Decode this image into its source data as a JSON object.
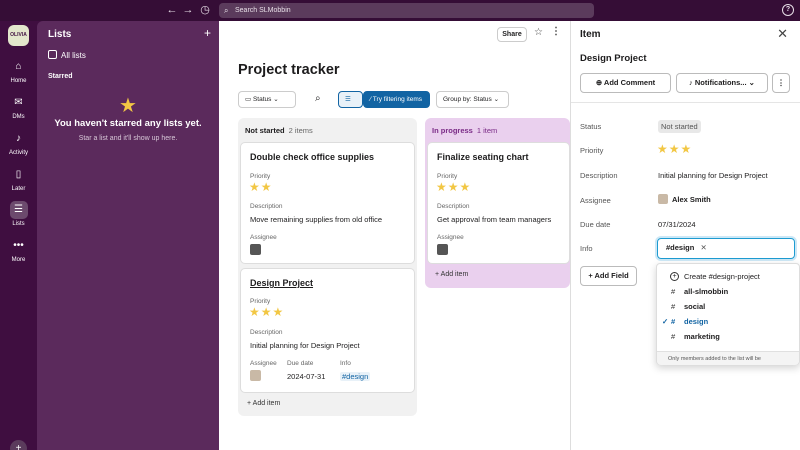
{
  "topbar": {
    "back_icon": "arrow-left-icon",
    "forward_icon": "arrow-right-icon",
    "history_icon": "clock-icon",
    "search_placeholder": "Search SLMobbin",
    "help_label": "?"
  },
  "workspace": {
    "label": "OLIVIA"
  },
  "rail": [
    {
      "label": "Home",
      "icon": "home-icon"
    },
    {
      "label": "DMs",
      "icon": "dms-icon"
    },
    {
      "label": "Activity",
      "icon": "bell-icon"
    },
    {
      "label": "Later",
      "icon": "bookmark-icon"
    },
    {
      "label": "Lists",
      "icon": "lists-icon"
    },
    {
      "label": "More",
      "icon": "more-icon"
    }
  ],
  "lists_sidebar": {
    "title": "Lists",
    "add": "+",
    "all_lists": "All lists",
    "starred_header": "Starred",
    "empty_title": "You haven't starred any lists yet.",
    "empty_sub": "Star a list and it'll show up here."
  },
  "main": {
    "share": "Share",
    "title": "Project tracker",
    "toolbar": {
      "status": "Status",
      "filter": "Try filtering items",
      "group_by": "Group by: Status"
    },
    "columns": {
      "not_started": {
        "name": "Not started",
        "count": "2 items",
        "add_item": "Add item",
        "cards": [
          {
            "title": "Double check office supplies",
            "priority_label": "Priority",
            "priority": 2,
            "priority_stars": "★★",
            "description_label": "Description",
            "description": "Move remaining supplies from old office",
            "assignee_label": "Assignee"
          },
          {
            "title": "Design Project",
            "priority_label": "Priority",
            "priority": 3,
            "priority_stars": "★★★",
            "description_label": "Description",
            "description": "Initial planning for Design Project",
            "assignee_label": "Assignee",
            "due_label": "Due date",
            "due": "2024-07-31",
            "info_label": "Info",
            "info": "#design"
          }
        ]
      },
      "in_progress": {
        "name": "In progress",
        "count": "1 item",
        "add_item": "Add item",
        "cards": [
          {
            "title": "Finalize seating chart",
            "priority_label": "Priority",
            "priority": 3,
            "priority_stars": "★★★",
            "description_label": "Description",
            "description": "Get approval from team managers",
            "assignee_label": "Assignee"
          }
        ]
      }
    }
  },
  "panel": {
    "title": "Item",
    "item_name": "Design Project",
    "add_comment": "Add Comment",
    "notifications": "Notifications...",
    "fields": {
      "status_label": "Status",
      "status": "Not started",
      "priority_label": "Priority",
      "priority": 3,
      "priority_stars": "★★★",
      "description_label": "Description",
      "description": "Initial planning for Design Project",
      "assignee_label": "Assignee",
      "assignee": "Alex Smith",
      "due_label": "Due date",
      "due": "07/31/2024",
      "info_label": "Info",
      "info_chip": "design"
    },
    "add_field": "Add Field",
    "dropdown": {
      "create": "Create #design-project",
      "options": [
        {
          "name": "all-slmobbin",
          "selected": false
        },
        {
          "name": "social",
          "selected": false
        },
        {
          "name": "design",
          "selected": true
        },
        {
          "name": "marketing",
          "selected": false
        }
      ],
      "footer": "Only members added to the list will be"
    }
  },
  "colors": {
    "aubergine": "#3f0e40",
    "sidebar": "#5b2a5c",
    "accent_blue": "#1264a3",
    "star": "#f2c744",
    "in_progress_bg": "#ead0ee"
  }
}
